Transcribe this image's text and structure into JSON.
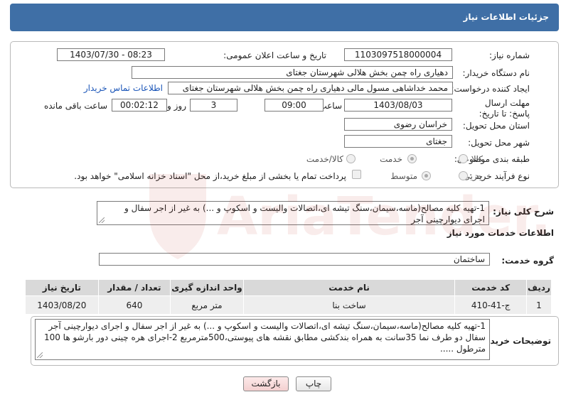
{
  "header": {
    "title": "جزئیات اطلاعات نیاز"
  },
  "fields": {
    "need_number_label": "شماره نیاز:",
    "need_number": "1103097518000004",
    "announce_label": "تاریخ و ساعت اعلان عمومی:",
    "announce_value": "1403/07/30 - 08:23",
    "buyer_org_label": "نام دستگاه خریدار:",
    "buyer_org": "دهیاری راه چمن بخش هلالی شهرستان جغتای",
    "creator_label": "ایجاد کننده درخواست:",
    "creator": "محمد خداشاهی مسول مالی دهیاری راه چمن بخش هلالی شهرستان جغتای",
    "contact_link": "اطلاعات تماس خریدار",
    "deadline_label": "مهلت ارسال پاسخ: تا تاریخ:",
    "deadline_date": "1403/08/03",
    "time_label": "ساعت",
    "deadline_time": "09:00",
    "days_value": "3",
    "days_label": "روز و",
    "remaining_time": "00:02:12",
    "remaining_label": "ساعت باقی مانده",
    "province_label": "استان محل تحویل:",
    "province": "خراسان رضوی",
    "city_label": "شهر محل تحویل:",
    "city": "جغتای",
    "category_label": "طبقه بندی موضوعی:",
    "category_options": [
      "کالا",
      "خدمت",
      "کالا/خدمت"
    ],
    "process_label": "نوع فرآیند خرید :",
    "process_options": [
      "جزیی",
      "متوسط"
    ],
    "payment_note": "پرداخت تمام یا بخشی از مبلغ خرید،از محل \"اسناد خزانه اسلامی\" خواهد بود."
  },
  "summary": {
    "label": "شرح کلی نیاز:",
    "text": "1-تهیه کلیه مصالح(ماسه،سیمان،سنگ تیشه ای،اتصالات والیست و اسکوپ و ...) به غیر از اجر سفال و اجرای دیوارچینی آجر"
  },
  "services": {
    "section_title": "اطلاعات خدمات مورد نیاز",
    "group_label": "گروه خدمت:",
    "group_value": "ساختمان",
    "columns": [
      "ردیف",
      "کد خدمت",
      "نام خدمت",
      "واحد اندازه گیری",
      "تعداد / مقدار",
      "تاریخ نیاز"
    ],
    "rows": [
      {
        "index": "1",
        "code": "ج-41-410",
        "name": "ساخت بنا",
        "unit": "متر مربع",
        "qty": "640",
        "date": "1403/08/20"
      }
    ]
  },
  "buyer_notes": {
    "label": "توضیحات خریدار:",
    "text": "1-تهیه کلیه مصالح(ماسه،سیمان،سنگ تیشه ای،اتصالات والیست و اسکوپ و ...) به غیر از اجر سفال و اجرای دیوارچینی آجر سفال دو طرف نما  35سانت به همراه بندکشی  مطابق نقشه های پیوستی،500مترمربع 2-اجرای هره چینی دور بارشو ها 100 مترطول ....."
  },
  "buttons": {
    "print": "چاپ",
    "back": "بازگشت"
  },
  "watermark": {
    "text": "AriaTender.neT"
  },
  "colors": {
    "header": "#3f6fa6",
    "link": "#1a55b8",
    "watermark": "#c0392b"
  }
}
